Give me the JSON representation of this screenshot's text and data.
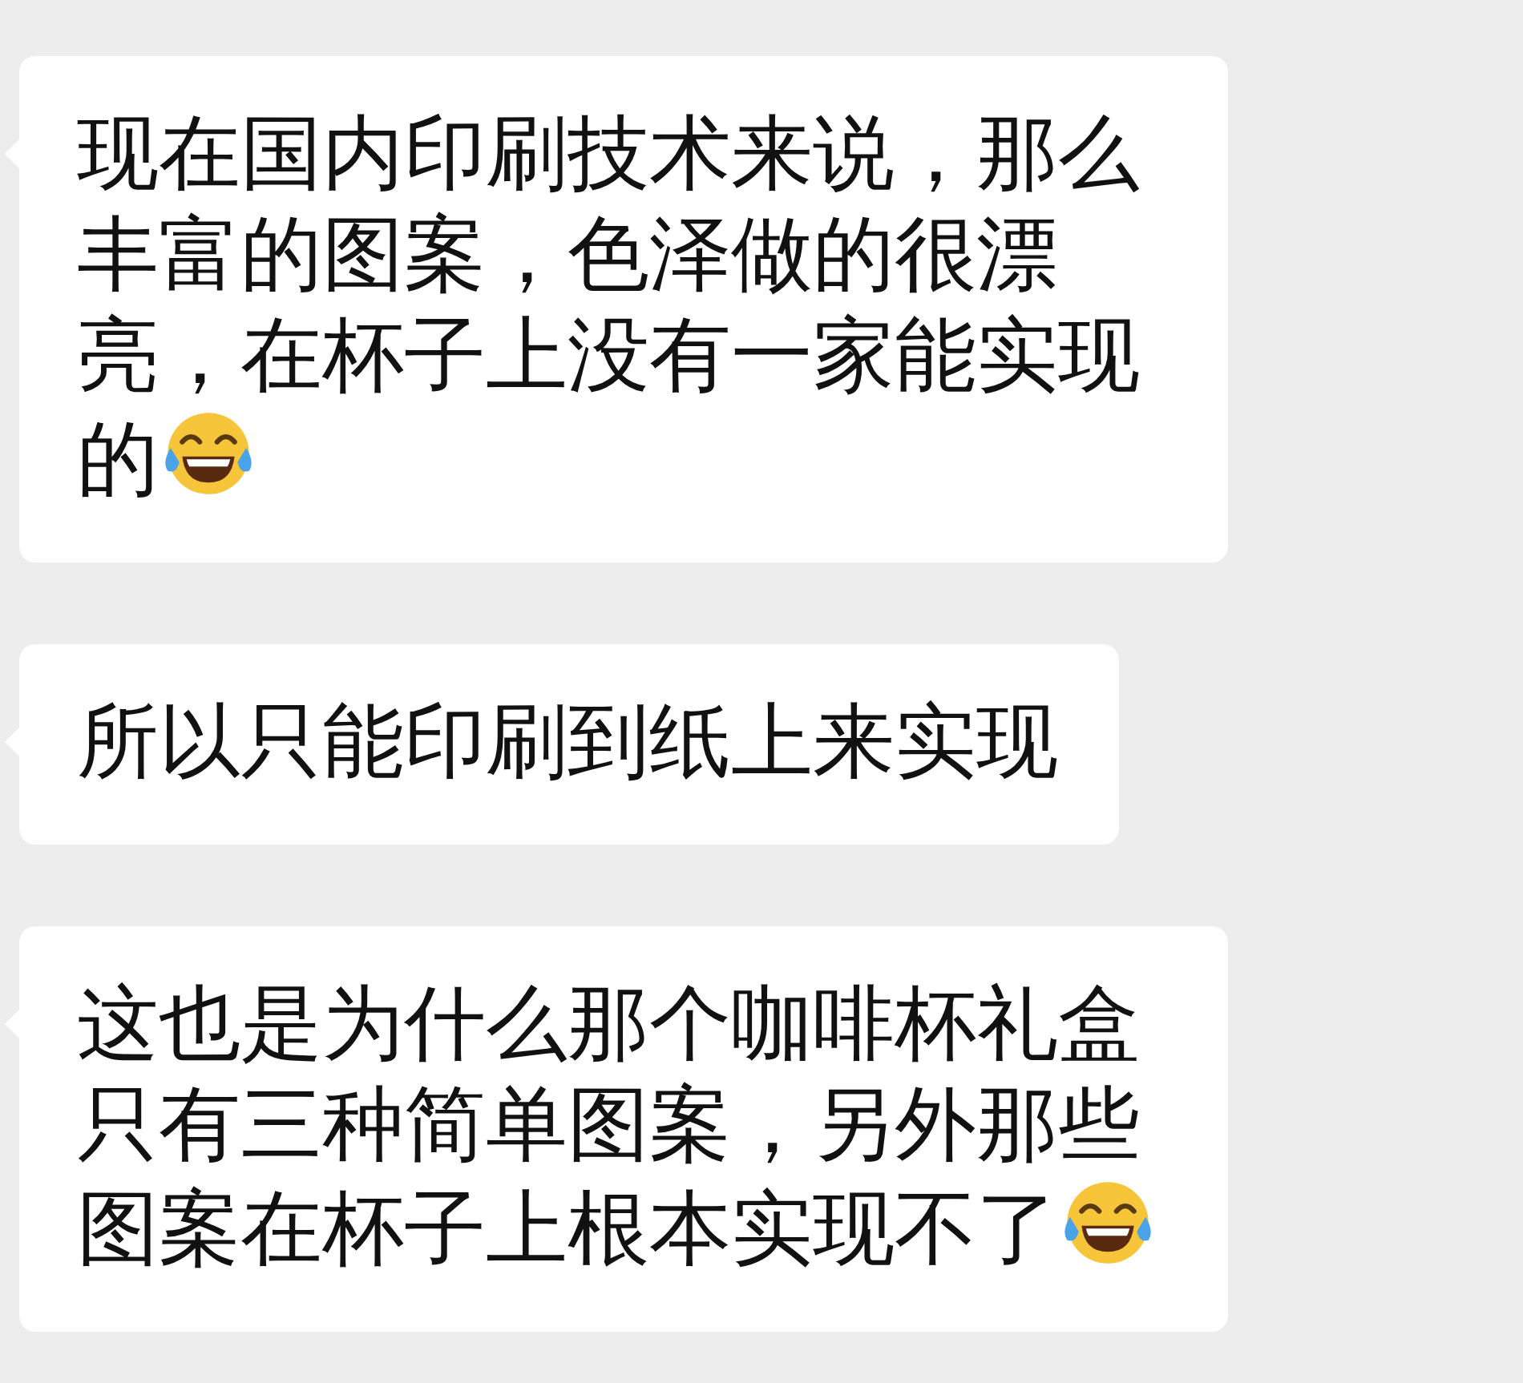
{
  "messages": [
    {
      "text": "现在国内印刷技术来说，那么丰富的图案，色泽做的很漂亮，在杯子上没有一家能实现的",
      "ends_with_emoji": true
    },
    {
      "text": "所以只能印刷到纸上来实现",
      "ends_with_emoji": false
    },
    {
      "text": "这也是为什么那个咖啡杯礼盒只有三种简单图案，另外那些图案在杯子上根本实现不了",
      "ends_with_emoji": true
    }
  ]
}
